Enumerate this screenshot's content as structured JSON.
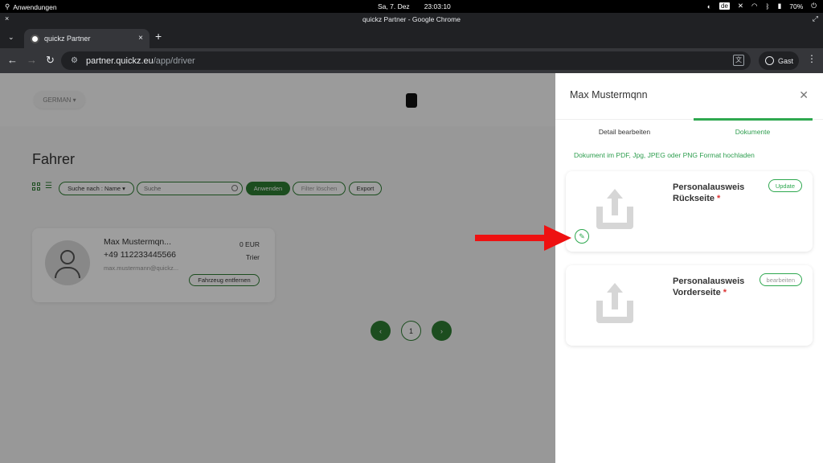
{
  "system": {
    "apps_label": "Anwendungen",
    "date": "Sa, 7. Dez",
    "time": "23:03:10",
    "lang": "de",
    "battery": "70%",
    "icons": [
      "search-icon",
      "contrast-icon",
      "mute-icon",
      "wifi-icon",
      "bluetooth-icon",
      "battery-icon",
      "power-icon"
    ]
  },
  "window": {
    "title": "quickz Partner - Google Chrome"
  },
  "tab": {
    "label": "quickz Partner"
  },
  "omnibox": {
    "host": "partner.quickz.eu",
    "path": "/app/driver"
  },
  "profile": {
    "label": "Gast"
  },
  "app": {
    "language": "GERMAN",
    "page_title": "Fahrer",
    "filter": {
      "search_by": "Suche nach : Name",
      "search_placeholder": "Suche",
      "apply": "Anwenden",
      "clear": "Filter löschen",
      "export": "Export"
    },
    "driver_card": {
      "name": "Max Mustermqn...",
      "phone": "+49 112233445566",
      "email": "max.mustermann@quickz...",
      "balance": "0 EUR",
      "city": "Trier",
      "vehicle_button": "Fahrzeug entfernen"
    },
    "pagination": {
      "current": "1"
    }
  },
  "panel": {
    "title": "Max Mustermqnn",
    "tabs": [
      "Detail bearbeiten",
      "Dokumente"
    ],
    "active_tab": "Dokumente",
    "hint": "Dokument im PDF, Jpg, JPEG oder PNG Format hochladen",
    "documents": [
      {
        "title_line1": "Personalausweis",
        "title_line2": "Rückseite",
        "required": "*",
        "button": "Update"
      },
      {
        "title_line1": "Personalausweis",
        "title_line2": "Vorderseite",
        "required": "*",
        "button": "bearbeiten"
      }
    ]
  },
  "colors": {
    "accent": "#2ea84f",
    "annotation": "#ee1111"
  }
}
